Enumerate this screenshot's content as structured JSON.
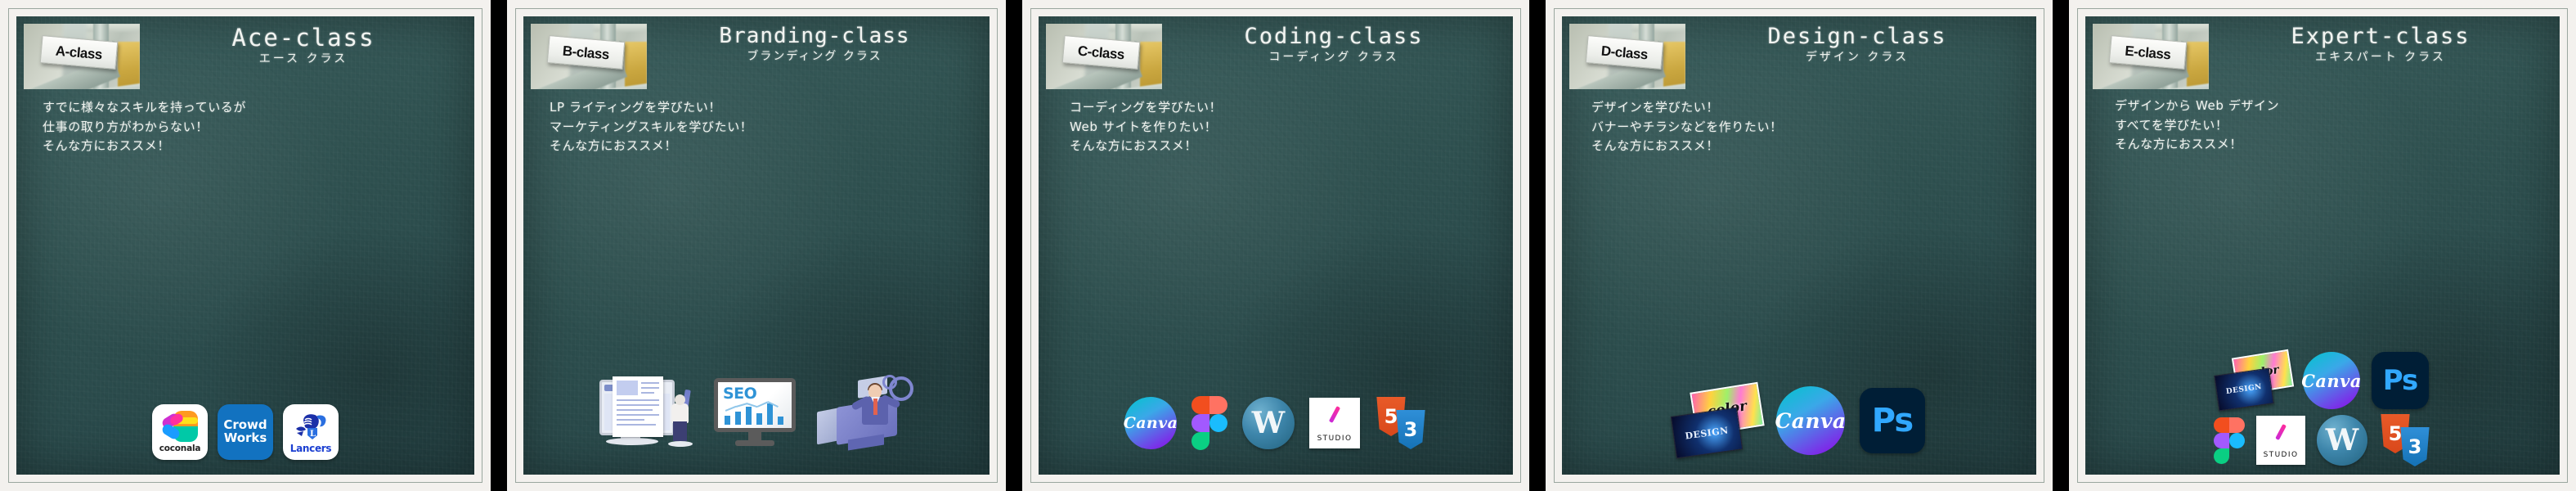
{
  "meta": {
    "layout": "five-class-cards-strip",
    "board_color": "#2f5150",
    "card_bg": "#f3f1ee",
    "gap_color": "#000000",
    "chalk_color": "#f0f4f0"
  },
  "cards": [
    {
      "id": "a-class",
      "sign_label": "A-class",
      "title_en": "Ace-class",
      "title_jp": "エース クラス",
      "copy": [
        "すでに様々なスキルを持っているが",
        "仕事の取り方がわからない！",
        "そんな方におススメ！"
      ],
      "logos": [
        {
          "name": "coconala",
          "label": "coconala"
        },
        {
          "name": "crowdworks",
          "label": "Crowd Works",
          "label_line1": "Crowd",
          "label_line2": "Works",
          "color": "#1272c0"
        },
        {
          "name": "lancers",
          "label": "Lancers",
          "color": "#1b3fd1"
        }
      ]
    },
    {
      "id": "b-class",
      "sign_label": "B-class",
      "title_en": "Branding-class",
      "title_jp": "ブランディング クラス",
      "copy": [
        "LP ライティングを学びたい！",
        "マーケティングスキルを学びたい！",
        "そんな方におススメ！"
      ],
      "logos": [
        {
          "name": "web-writing-illustration",
          "label": ""
        },
        {
          "name": "seo-monitor-illustration",
          "label": "SEO"
        },
        {
          "name": "marketing-analytics-illustration",
          "label": ""
        }
      ]
    },
    {
      "id": "c-class",
      "sign_label": "C-class",
      "title_en": "Coding-class",
      "title_jp": "コーディング クラス",
      "copy": [
        "コーディングを学びたい！",
        "Web サイトを作りたい！",
        "そんな方におススメ！"
      ],
      "logos": [
        {
          "name": "canva",
          "label": "Canva"
        },
        {
          "name": "figma",
          "label": "Figma"
        },
        {
          "name": "wordpress",
          "label": "W"
        },
        {
          "name": "studio",
          "label": "STUDIO"
        },
        {
          "name": "html5",
          "label": "5",
          "color": "#e44d26"
        },
        {
          "name": "css3",
          "label": "3",
          "color": "#1572b6"
        }
      ]
    },
    {
      "id": "d-class",
      "sign_label": "D-class",
      "title_en": "Design-class",
      "title_jp": "デザイン クラス",
      "copy": [
        "デザインを学びたい！",
        "バナーやチラシなどを作りたい！",
        "そんな方におススメ！"
      ],
      "logos": [
        {
          "name": "color-thumbnail",
          "label": "color"
        },
        {
          "name": "design-thumbnail",
          "label": "DESIGN"
        },
        {
          "name": "canva",
          "label": "Canva"
        },
        {
          "name": "photoshop",
          "label": "Ps",
          "color": "#31a8ff"
        }
      ]
    },
    {
      "id": "e-class",
      "sign_label": "E-class",
      "title_en": "Expert-class",
      "title_jp": "エキスパート クラス",
      "copy": [
        "デザインから Web デザイン",
        "すべてを学びたい！",
        "そんな方におススメ！"
      ],
      "logos_row1": [
        {
          "name": "color-thumbnail",
          "label": "color"
        },
        {
          "name": "design-thumbnail",
          "label": "DESIGN"
        },
        {
          "name": "canva",
          "label": "Canva"
        },
        {
          "name": "photoshop",
          "label": "Ps",
          "color": "#31a8ff"
        }
      ],
      "logos_row2": [
        {
          "name": "figma",
          "label": "Figma"
        },
        {
          "name": "studio",
          "label": "STUDIO"
        },
        {
          "name": "wordpress",
          "label": "W"
        },
        {
          "name": "html5",
          "label": "5",
          "color": "#e44d26"
        },
        {
          "name": "css3",
          "label": "3",
          "color": "#1572b6"
        }
      ]
    }
  ]
}
